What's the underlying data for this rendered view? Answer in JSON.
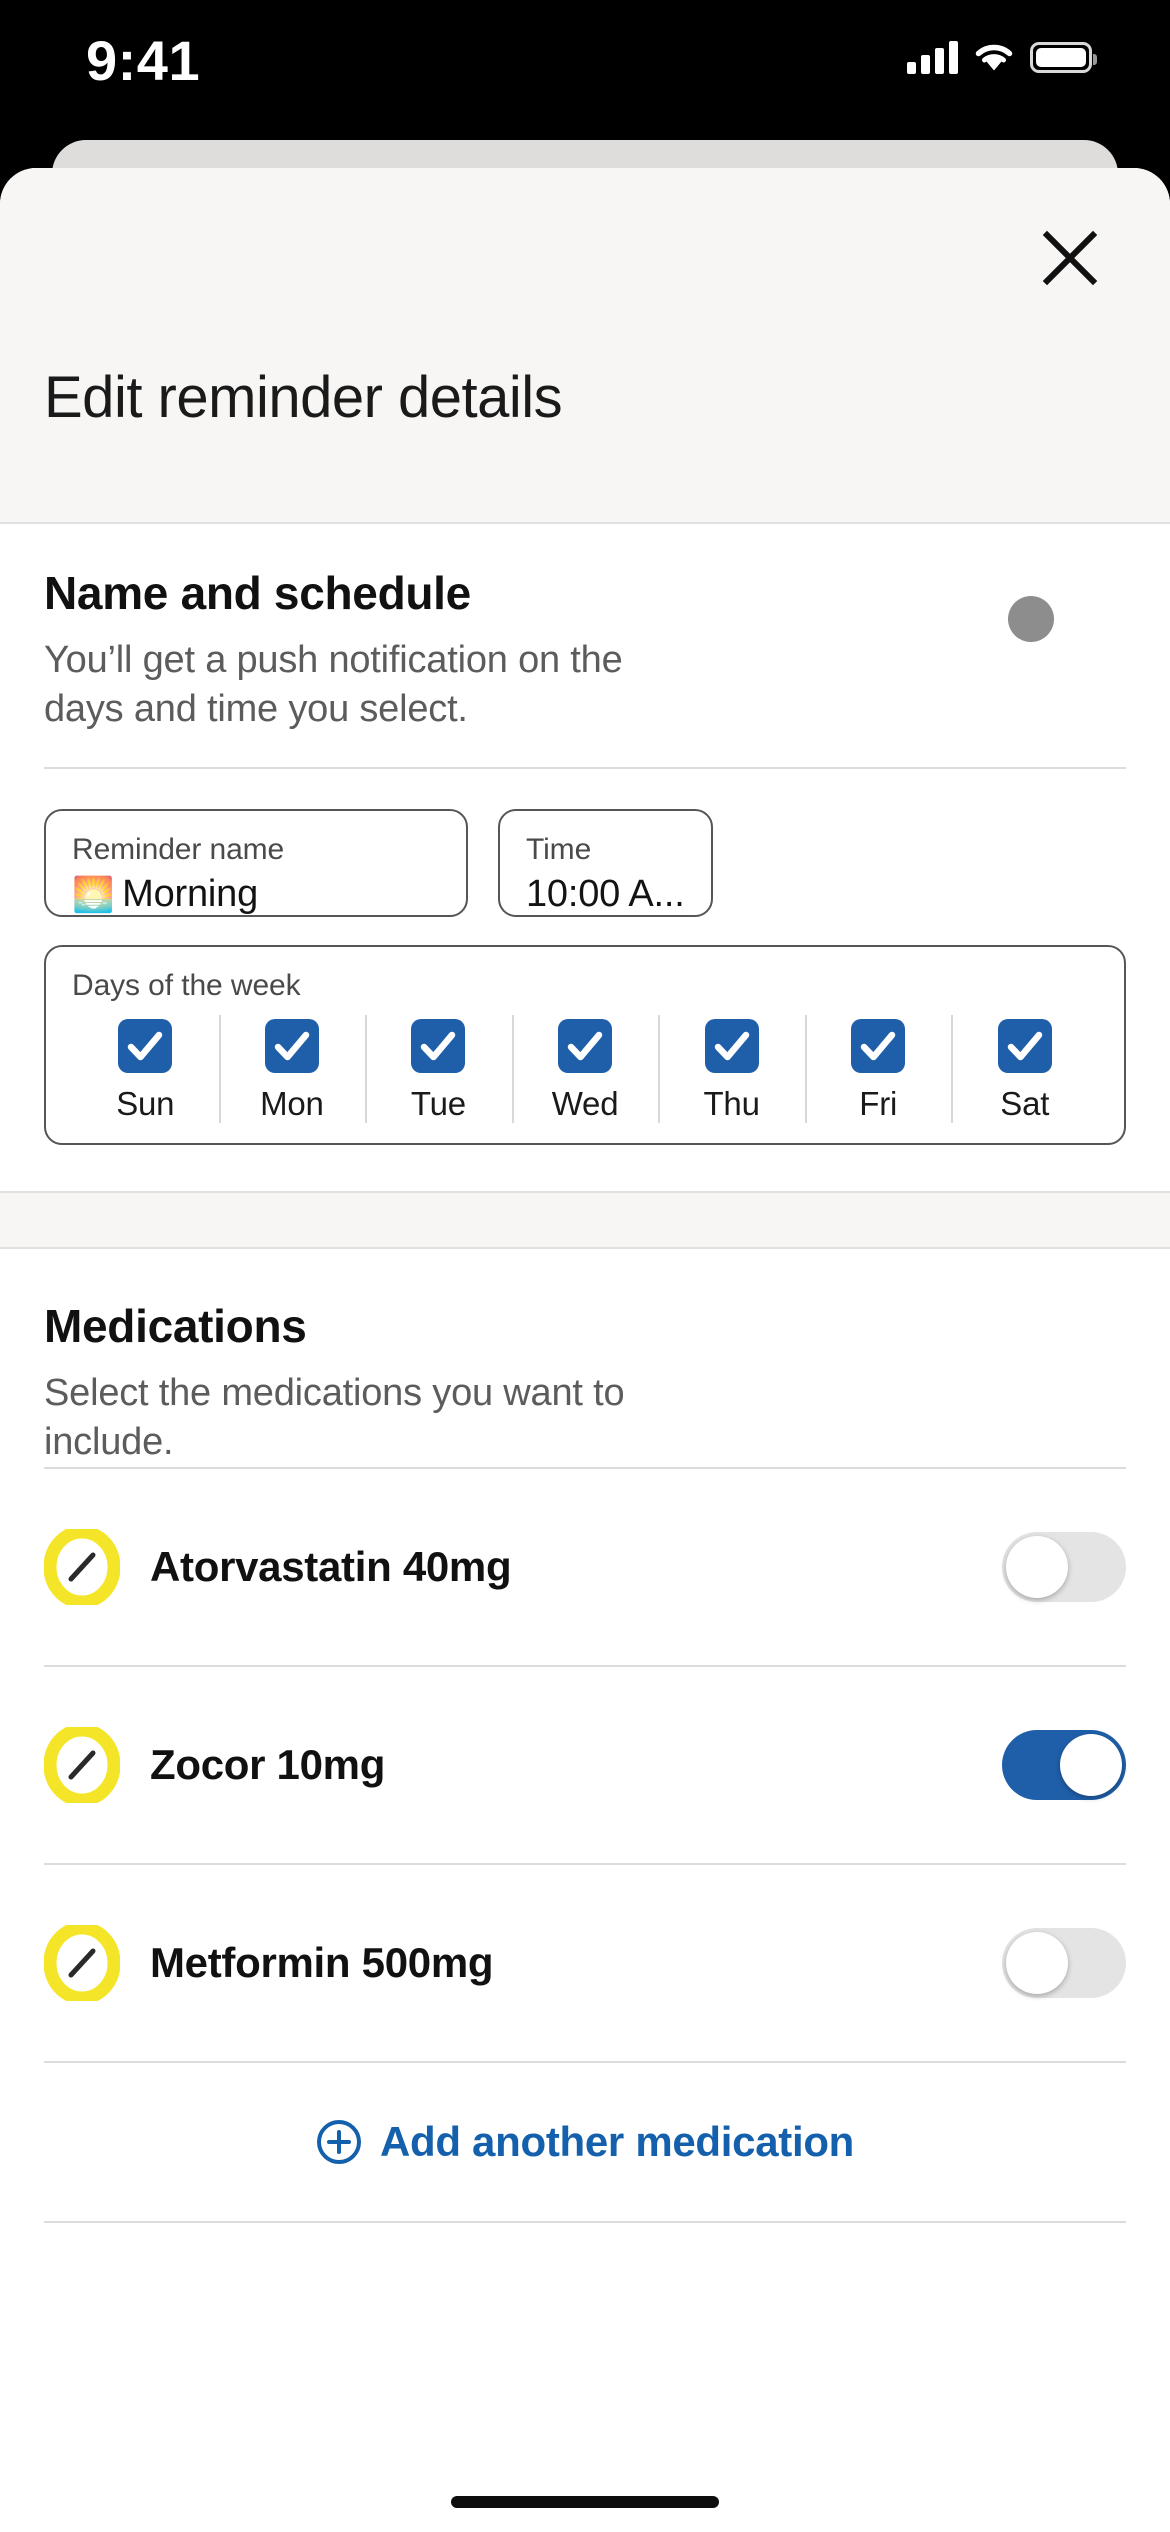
{
  "status_bar": {
    "time": "9:41",
    "signal_icon": "cellular-signal-icon",
    "wifi_icon": "wifi-icon",
    "battery_icon": "battery-icon"
  },
  "sheet": {
    "close_icon": "close-icon",
    "title": "Edit reminder details"
  },
  "schedule": {
    "title": "Name and schedule",
    "description": "You’ll get a push notification on the days and time you select.",
    "name_field": {
      "label": "Reminder name",
      "emoji": "🌅",
      "value": "Morning"
    },
    "time_field": {
      "label": "Time",
      "value": "10:00 A..."
    },
    "days_label": "Days of the week",
    "days": [
      {
        "label": "Sun",
        "checked": true
      },
      {
        "label": "Mon",
        "checked": true
      },
      {
        "label": "Tue",
        "checked": true
      },
      {
        "label": "Wed",
        "checked": true
      },
      {
        "label": "Thu",
        "checked": true
      },
      {
        "label": "Fri",
        "checked": true
      },
      {
        "label": "Sat",
        "checked": true
      }
    ]
  },
  "medications": {
    "title": "Medications",
    "description": "Select the medications you want to include.",
    "items": [
      {
        "name": "Atorvastatin 40mg",
        "icon": "pill-icon",
        "enabled": false
      },
      {
        "name": "Zocor 10mg",
        "icon": "pill-icon",
        "enabled": true
      },
      {
        "name": "Metformin 500mg",
        "icon": "pill-icon",
        "enabled": false
      }
    ],
    "add_label": "Add another medication",
    "add_icon": "plus-circle-icon"
  },
  "colors": {
    "accent_blue": "#1f5fa9",
    "link_blue": "#1560ac",
    "pill_yellow": "#f5e528",
    "toggle_off": "#e4e4e4",
    "sheet_header": "#f7f6f4"
  }
}
